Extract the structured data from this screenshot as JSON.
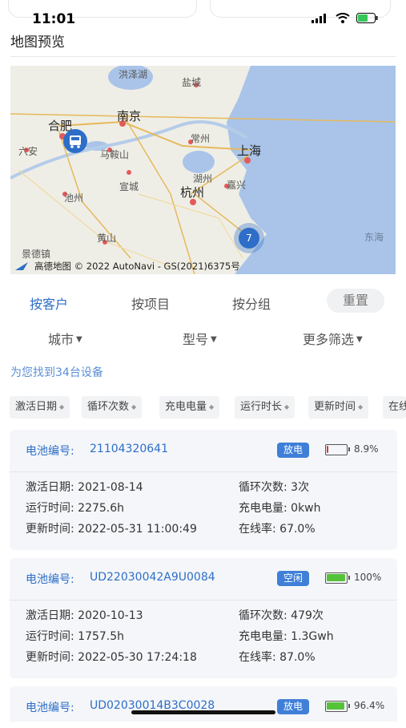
{
  "status": {
    "time": "11:01"
  },
  "page": {
    "title": "地图预览"
  },
  "map": {
    "cities": [
      "合肥",
      "南京",
      "上海",
      "杭州"
    ],
    "labels": [
      "洪泽湖",
      "盐城",
      "六安",
      "马鞍山",
      "常州",
      "宣城",
      "湖州",
      "嘉兴",
      "池州",
      "黄山",
      "景德镇",
      "东海"
    ],
    "cluster_count": "7",
    "attribution": "高德地图 © 2022 AutoNavi - GS(2021)6375号"
  },
  "tabs": {
    "by_customer": "按客户",
    "by_project": "按项目",
    "by_group": "按分组",
    "reset": "重置"
  },
  "filters": {
    "city": "城市",
    "model": "型号",
    "more": "更多筛选"
  },
  "result_text": "为您找到34台设备",
  "sort_options": [
    "激活日期",
    "循环次数",
    "充电电量",
    "运行时长",
    "更新时间",
    "在线"
  ],
  "labels": {
    "battery_no": "电池编号:",
    "activation_date": "激活日期:",
    "run_time": "运行时间:",
    "update_time": "更新时间:",
    "cycle_count": "循环次数:",
    "charge_energy": "充电电量:",
    "online_rate": "在线率:"
  },
  "devices": [
    {
      "sn": "21104320641",
      "status": "放电",
      "battery_pct": "8.9%",
      "battery_level": 0.089,
      "activation_date": "2021-08-14",
      "run_time": "2275.6h",
      "update_time": "2022-05-31 11:00:49",
      "cycle_count": "3次",
      "charge_energy": "0kwh",
      "online_rate": "67.0%"
    },
    {
      "sn": "UD22030042A9U0084",
      "status": "空闲",
      "battery_pct": "100%",
      "battery_level": 1.0,
      "activation_date": "2020-10-13",
      "run_time": "1757.5h",
      "update_time": "2022-05-30 17:24:18",
      "cycle_count": "479次",
      "charge_energy": "1.3Gwh",
      "online_rate": "87.0%"
    },
    {
      "sn": "UD02030014B3C0028",
      "status": "放电",
      "battery_pct": "96.4%",
      "battery_level": 0.964
    }
  ]
}
